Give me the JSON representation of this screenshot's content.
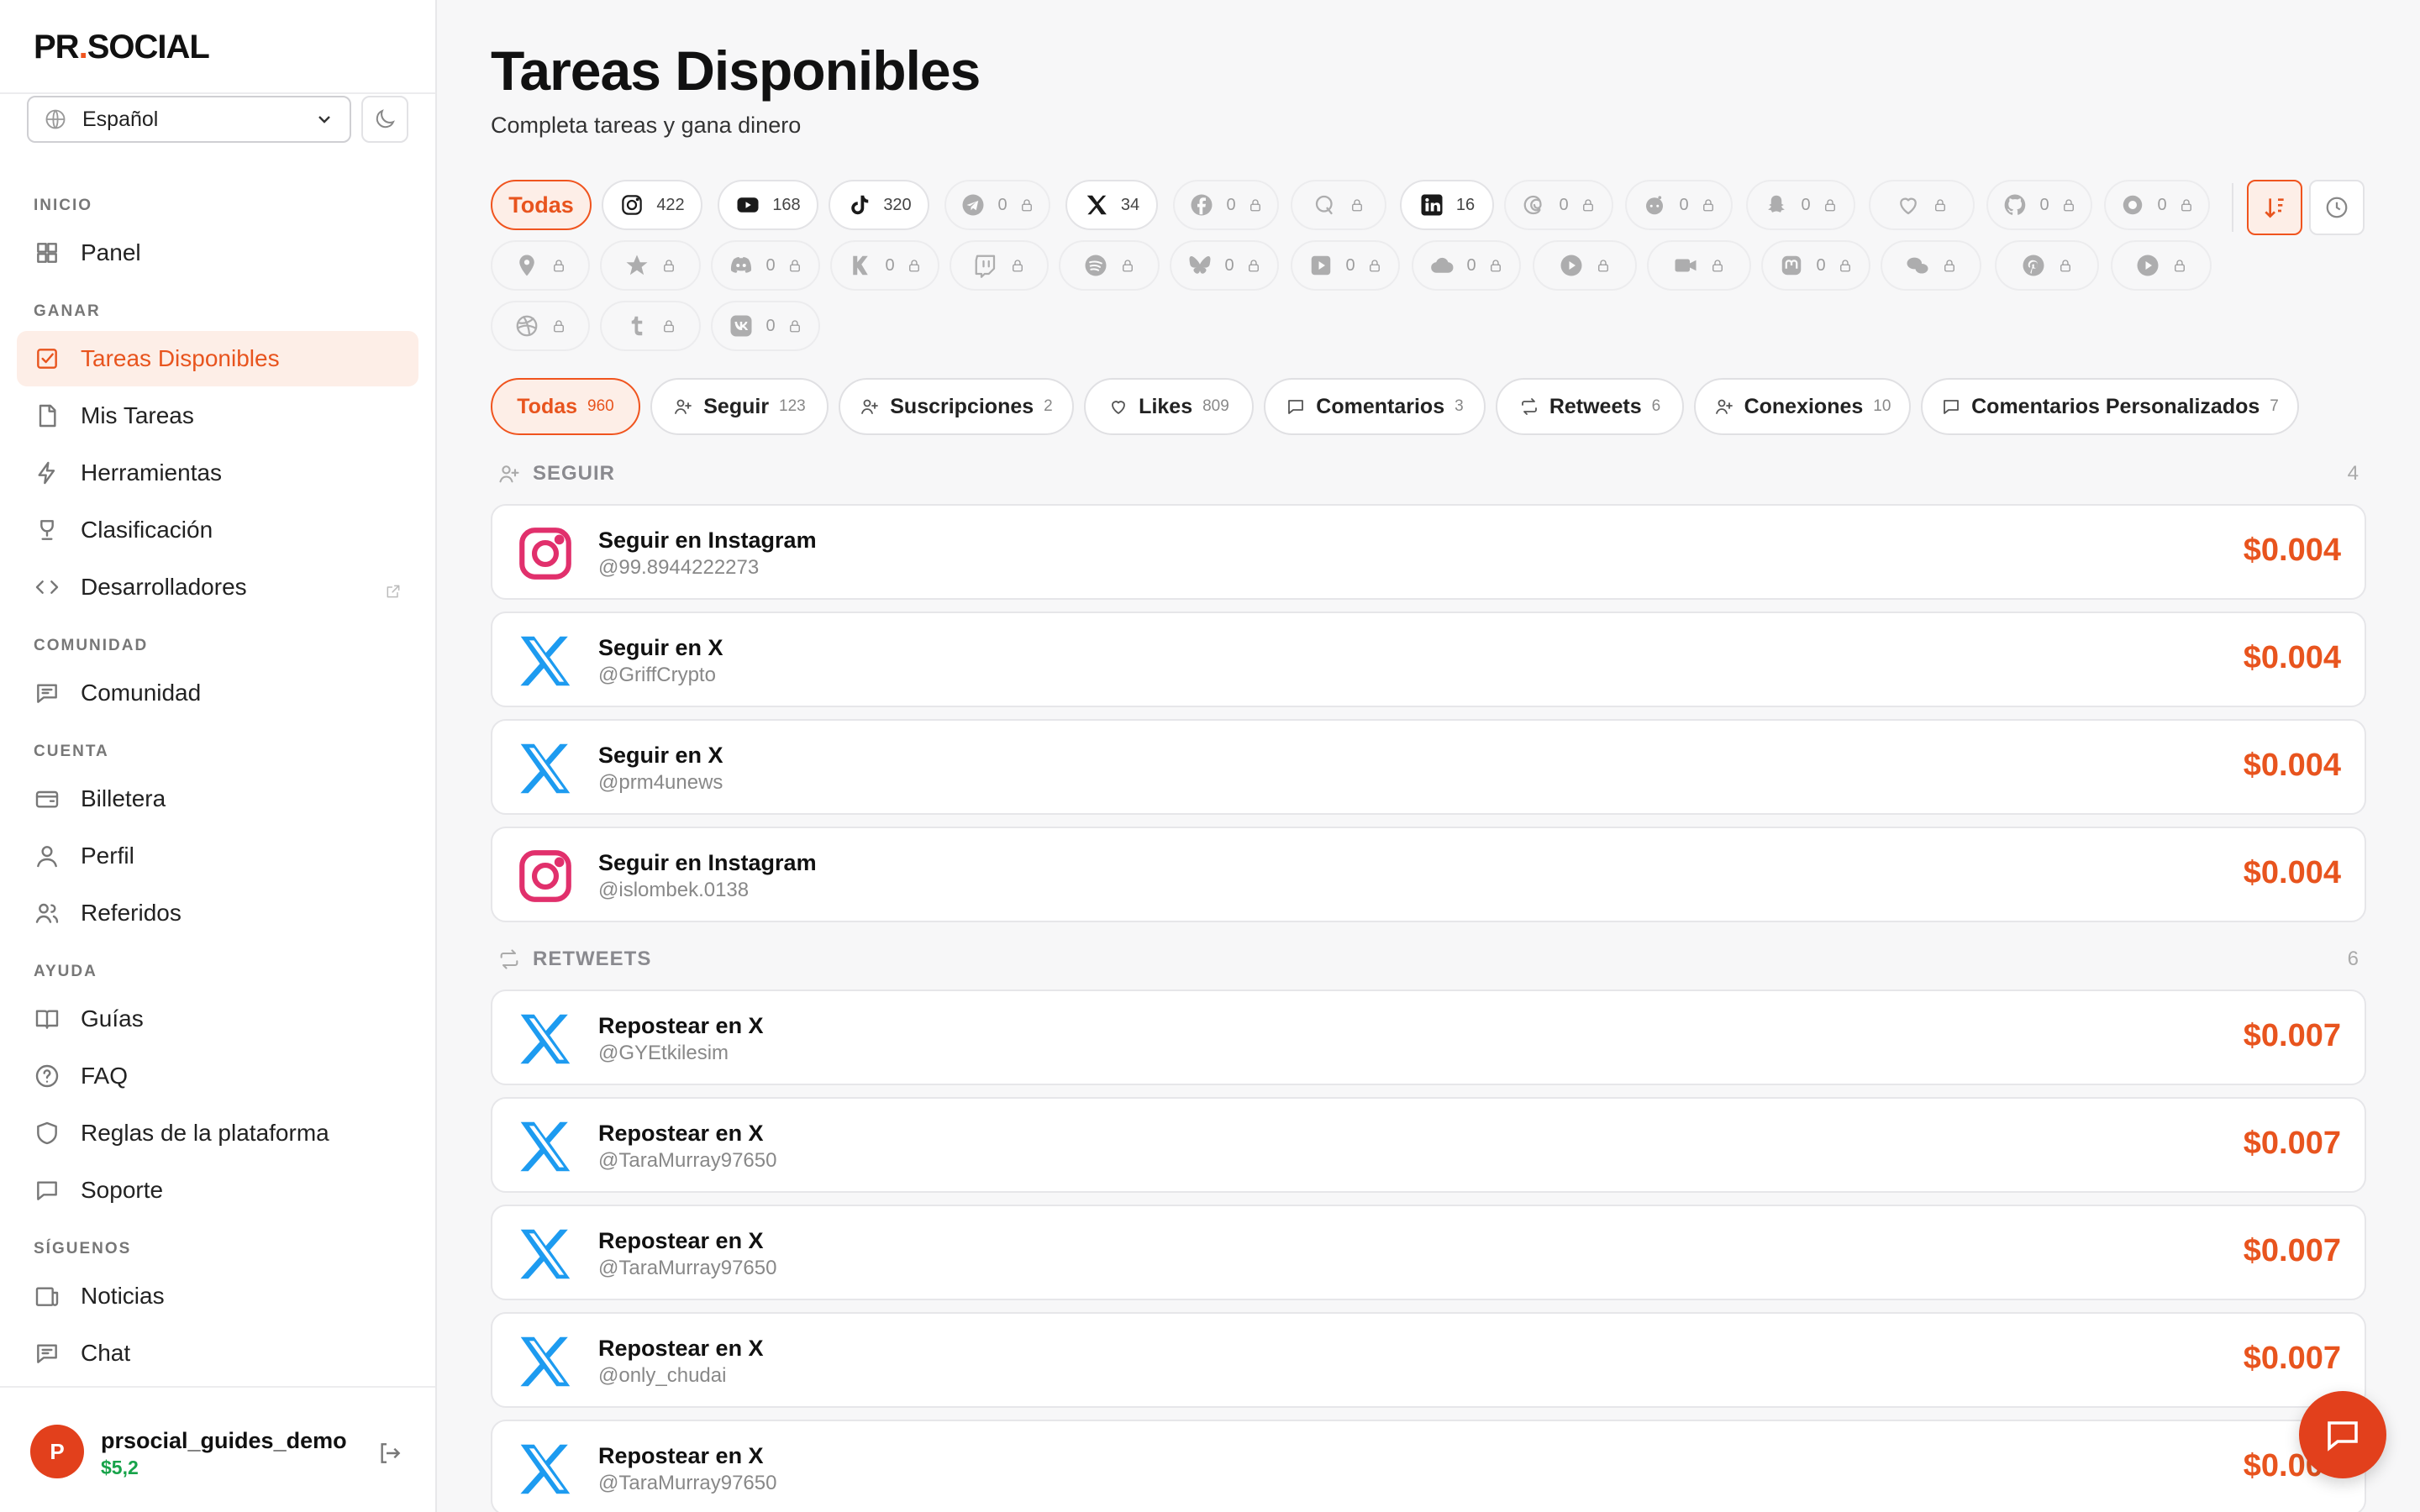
{
  "brand": {
    "name_a": "PR",
    "dot": ".",
    "name_b": "SOCIAL",
    "accent": "#f0541e"
  },
  "language": {
    "selected": "Español"
  },
  "nav": {
    "sections": [
      {
        "label": "INICIO",
        "items": [
          {
            "label": "Panel",
            "icon": "grid-icon"
          }
        ]
      },
      {
        "label": "GANAR",
        "items": [
          {
            "label": "Tareas Disponibles",
            "icon": "checkbox-icon",
            "active": true
          },
          {
            "label": "Mis Tareas",
            "icon": "document-icon"
          },
          {
            "label": "Herramientas",
            "icon": "bolt-icon"
          },
          {
            "label": "Clasificación",
            "icon": "trophy-icon"
          },
          {
            "label": "Desarrolladores",
            "icon": "code-icon",
            "external": true
          }
        ]
      },
      {
        "label": "COMUNIDAD",
        "items": [
          {
            "label": "Comunidad",
            "icon": "message-icon"
          }
        ]
      },
      {
        "label": "CUENTA",
        "items": [
          {
            "label": "Billetera",
            "icon": "wallet-icon"
          },
          {
            "label": "Perfil",
            "icon": "user-icon"
          },
          {
            "label": "Referidos",
            "icon": "users-icon"
          }
        ]
      },
      {
        "label": "AYUDA",
        "items": [
          {
            "label": "Guías",
            "icon": "book-icon"
          },
          {
            "label": "FAQ",
            "icon": "question-icon"
          },
          {
            "label": "Reglas de la plataforma",
            "icon": "shield-icon"
          },
          {
            "label": "Soporte",
            "icon": "chat-icon"
          }
        ]
      },
      {
        "label": "SÍGUENOS",
        "items": [
          {
            "label": "Noticias",
            "icon": "news-icon"
          },
          {
            "label": "Chat",
            "icon": "message-icon"
          }
        ]
      }
    ]
  },
  "user": {
    "initial": "P",
    "name": "prsocial_guides_demo",
    "balance": "$5,2"
  },
  "header": {
    "title": "Tareas Disponibles",
    "subtitle": "Completa tareas y gana dinero"
  },
  "platforms": [
    {
      "label": "Todas",
      "selected": true
    },
    {
      "icon": "instagram-icon",
      "count": "422"
    },
    {
      "icon": "youtube-icon",
      "count": "168"
    },
    {
      "icon": "tiktok-icon",
      "count": "320"
    },
    {
      "icon": "telegram-icon",
      "count": "0",
      "locked": true
    },
    {
      "icon": "x-icon",
      "count": "34"
    },
    {
      "icon": "facebook-icon",
      "count": "0",
      "locked": true
    },
    {
      "icon": "quora-icon",
      "count": "",
      "locked": true
    },
    {
      "icon": "linkedin-icon",
      "count": "16"
    },
    {
      "icon": "threads-icon",
      "count": "0",
      "locked": true
    },
    {
      "icon": "reddit-icon",
      "count": "0",
      "locked": true
    },
    {
      "icon": "snapchat-icon",
      "count": "0",
      "locked": true
    },
    {
      "icon": "heart-icon",
      "count": "",
      "locked": true
    },
    {
      "icon": "github-icon",
      "count": "0",
      "locked": true
    },
    {
      "icon": "circle-icon",
      "count": "0",
      "locked": true
    },
    {
      "icon": "map-pin-icon",
      "count": "",
      "locked": true
    },
    {
      "icon": "star-icon",
      "count": "",
      "locked": true
    },
    {
      "icon": "discord-icon",
      "count": "0",
      "locked": true
    },
    {
      "icon": "kick-icon",
      "count": "0",
      "locked": true
    },
    {
      "icon": "twitch-icon",
      "count": "",
      "locked": true
    },
    {
      "icon": "spotify-icon",
      "count": "",
      "locked": true
    },
    {
      "icon": "bluesky-icon",
      "count": "0",
      "locked": true
    },
    {
      "icon": "play-square-icon",
      "count": "0",
      "locked": true
    },
    {
      "icon": "cloud-icon",
      "count": "0",
      "locked": true
    },
    {
      "icon": "play-circle-icon",
      "count": "",
      "locked": true
    },
    {
      "icon": "video-icon",
      "count": "",
      "locked": true
    },
    {
      "icon": "mastodon-icon",
      "count": "0",
      "locked": true
    },
    {
      "icon": "wechat-icon",
      "count": "",
      "locked": true
    },
    {
      "icon": "pinterest-icon",
      "count": "",
      "locked": true
    },
    {
      "icon": "play-circle-icon",
      "count": "",
      "locked": true
    },
    {
      "icon": "dribbble-icon",
      "count": "",
      "locked": true
    },
    {
      "icon": "tumblr-icon",
      "count": "",
      "locked": true
    },
    {
      "icon": "vk-icon",
      "count": "0",
      "locked": true
    }
  ],
  "task_types": [
    {
      "label": "Todas",
      "count": "960",
      "selected": true
    },
    {
      "label": "Seguir",
      "count": "123",
      "icon": "user-plus-icon"
    },
    {
      "label": "Suscripciones",
      "count": "2",
      "icon": "user-plus-icon"
    },
    {
      "label": "Likes",
      "count": "809",
      "icon": "heart-icon"
    },
    {
      "label": "Comentarios",
      "count": "3",
      "icon": "comment-icon"
    },
    {
      "label": "Retweets",
      "count": "6",
      "icon": "repeat-icon"
    },
    {
      "label": "Conexiones",
      "count": "10",
      "icon": "user-plus-icon"
    },
    {
      "label": "Comentarios Personalizados",
      "count": "7",
      "icon": "comment-icon"
    }
  ],
  "groups": [
    {
      "label": "SEGUIR",
      "count": "4",
      "icon": "user-plus-icon",
      "tasks": [
        {
          "title": "Seguir en Instagram",
          "handle": "@99.8944222273",
          "price": "$0.004",
          "platform": "instagram"
        },
        {
          "title": "Seguir en X",
          "handle": "@GriffCrypto",
          "price": "$0.004",
          "platform": "x"
        },
        {
          "title": "Seguir en X",
          "handle": "@prm4unews",
          "price": "$0.004",
          "platform": "x"
        },
        {
          "title": "Seguir en Instagram",
          "handle": "@islombek.0138",
          "price": "$0.004",
          "platform": "instagram"
        }
      ]
    },
    {
      "label": "RETWEETS",
      "count": "6",
      "icon": "repeat-icon",
      "tasks": [
        {
          "title": "Repostear en X",
          "handle": "@GYEtkilesim",
          "price": "$0.007",
          "platform": "x"
        },
        {
          "title": "Repostear en X",
          "handle": "@TaraMurray97650",
          "price": "$0.007",
          "platform": "x"
        },
        {
          "title": "Repostear en X",
          "handle": "@TaraMurray97650",
          "price": "$0.007",
          "platform": "x"
        },
        {
          "title": "Repostear en X",
          "handle": "@only_chudai",
          "price": "$0.007",
          "platform": "x"
        },
        {
          "title": "Repostear en X",
          "handle": "@TaraMurray97650",
          "price": "$0.007",
          "platform": "x"
        }
      ]
    }
  ],
  "colors": {
    "accent": "#f0541e",
    "instagram": "#e1306c",
    "x": "#1d9bf0",
    "balance": "#17a34a"
  }
}
